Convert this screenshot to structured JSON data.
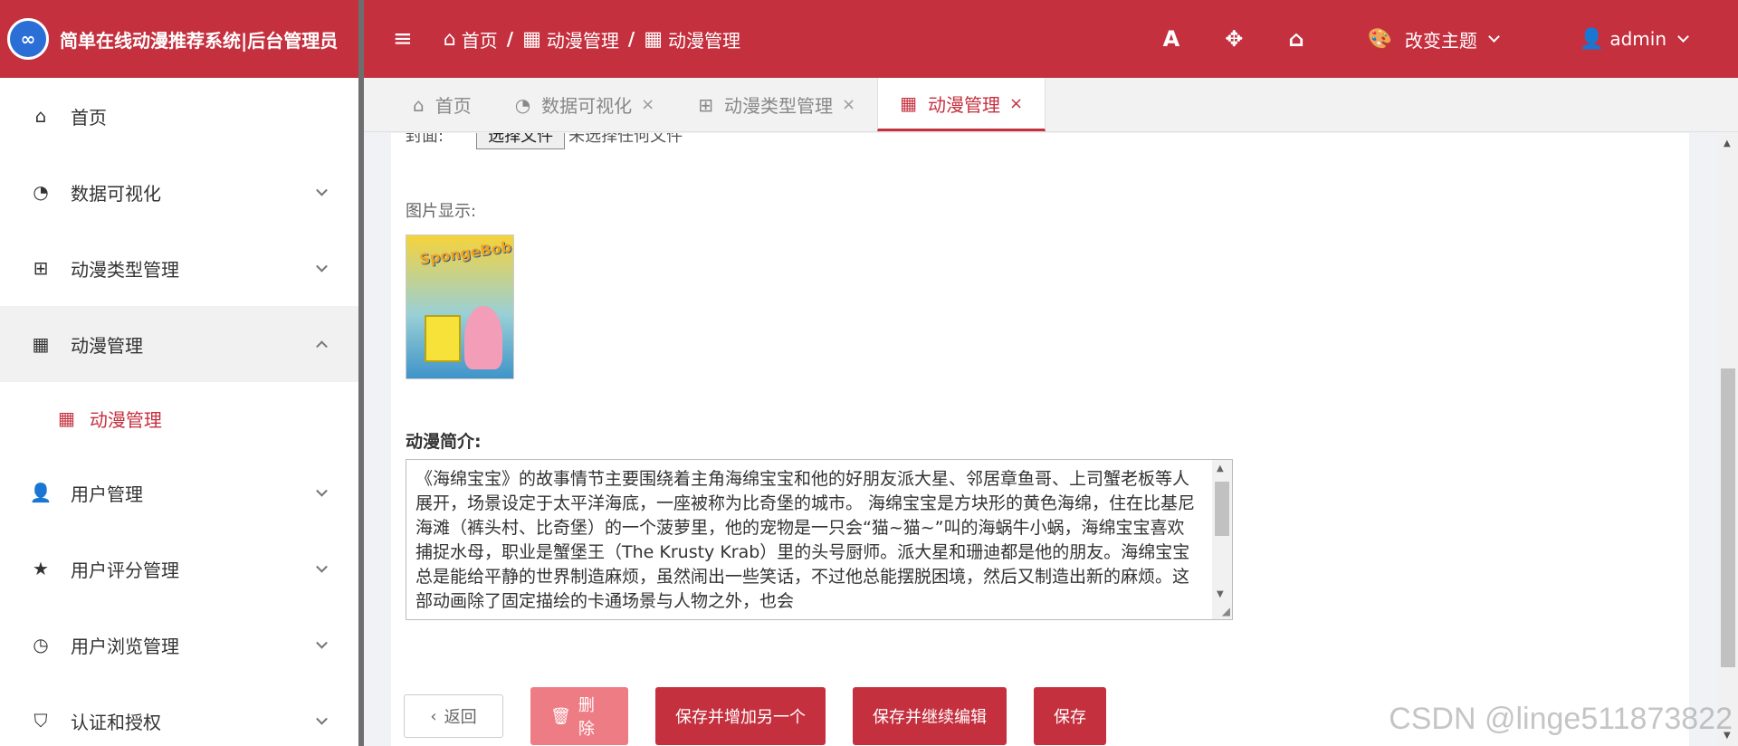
{
  "brand": {
    "logo_text": "∞",
    "title": "简单在线动漫推荐系统|后台管理员"
  },
  "sidebar": {
    "items": [
      {
        "label": "首页",
        "icon": "home-icon",
        "glyph": "⌂"
      },
      {
        "label": "数据可视化",
        "icon": "pie-chart-icon",
        "glyph": "◔"
      },
      {
        "label": "动漫类型管理",
        "icon": "grid-icon",
        "glyph": "⊞"
      },
      {
        "label": "动漫管理",
        "icon": "film-icon",
        "glyph": "▦"
      },
      {
        "label": "用户管理",
        "icon": "user-check-icon",
        "glyph": "👤"
      },
      {
        "label": "用户评分管理",
        "icon": "star-icon",
        "glyph": "★"
      },
      {
        "label": "用户浏览管理",
        "icon": "clock-icon",
        "glyph": "◷"
      },
      {
        "label": "认证和授权",
        "icon": "shield-icon",
        "glyph": "⛉"
      }
    ],
    "sub_item": {
      "label": "动漫管理",
      "icon": "film-icon",
      "glyph": "▦"
    }
  },
  "topbar": {
    "menu_glyph": "≡",
    "breadcrumb": [
      {
        "label": "首页",
        "glyph": "⌂"
      },
      {
        "label": "动漫管理",
        "glyph": "▦"
      },
      {
        "label": "动漫管理",
        "glyph": "▦"
      }
    ],
    "font_glyph": "A",
    "fullscreen_glyph": "✥",
    "home_glyph": "⌂",
    "theme_glyph": "🎨",
    "theme_label": "改变主题",
    "user_glyph": "👤",
    "user_label": "admin"
  },
  "tabs": [
    {
      "label": "首页",
      "glyph": "⌂",
      "closable": false
    },
    {
      "label": "数据可视化",
      "glyph": "◔",
      "closable": true
    },
    {
      "label": "动漫类型管理",
      "glyph": "⊞",
      "closable": true
    },
    {
      "label": "动漫管理",
      "glyph": "▦",
      "closable": true,
      "active": true
    }
  ],
  "tab_close_glyph": "×",
  "form": {
    "file_label": "封面:",
    "file_button": "选择文件",
    "file_status": "未选择任何文件",
    "image_label": "图片显示:",
    "image_title": "SpongeBob",
    "intro_label": "动漫简介:",
    "intro_text": "《海绵宝宝》的故事情节主要围绕着主角海绵宝宝和他的好朋友派大星、邻居章鱼哥、上司蟹老板等人展开，场景设定于太平洋海底，一座被称为比奇堡的城市。 海绵宝宝是方块形的黄色海绵，住在比基尼海滩（裤头村、比奇堡）的一个菠萝里，他的宠物是一只会“猫~猫~”叫的海蜗牛小蜗，海绵宝宝喜欢捕捉水母，职业是蟹堡王（The Krusty Krab）里的头号厨师。派大星和珊迪都是他的朋友。海绵宝宝总是能给平静的世界制造麻烦，虽然闹出一些笑话，不过他总能摆脱困境，然后又制造出新的麻烦。这部动画除了固定描绘的卡通场景与人物之外，也会"
  },
  "buttons": {
    "back": "返回",
    "back_glyph": "‹",
    "delete": "删除",
    "delete_glyph": "🗑",
    "save_add": "保存并增加另一个",
    "save_continue": "保存并继续编辑",
    "save": "保存"
  },
  "watermark": "CSDN @linge511873822",
  "colors": {
    "primary": "#c5303f",
    "delete": "#ee7c84",
    "sidebar_active_bg": "#f1f1f1"
  }
}
